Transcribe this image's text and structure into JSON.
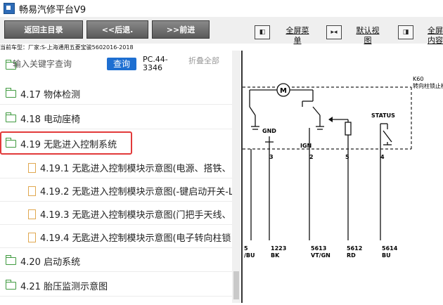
{
  "window": {
    "title": "畅易汽修平台V9"
  },
  "toolbar": {
    "back_main": "返回主目录",
    "back": "<<后退.",
    "forward": ">>前进",
    "view_buttons": [
      {
        "icon": "expand-left-icon",
        "label": "全屏菜单"
      },
      {
        "icon": "center-icon",
        "label": "默认视图"
      },
      {
        "icon": "expand-right-icon",
        "label": "全屏内容"
      }
    ]
  },
  "car_info": "当前车型：厂家:S-上海通用五菱宝骏5602016-2018",
  "search": {
    "placeholder": "输入关键字查询",
    "button": "查询",
    "code": "PC.44-3346",
    "collapse": "折叠全部"
  },
  "tree": [
    {
      "type": "folder",
      "label": "4.17 物体检测"
    },
    {
      "type": "folder",
      "label": "4.18 电动座椅"
    },
    {
      "type": "folder",
      "label": "4.19 无匙进入控制系统",
      "highlight": true
    },
    {
      "type": "doc",
      "label": "4.19.1 无匙进入控制模块示意图(电源、搭铁、"
    },
    {
      "type": "doc",
      "label": "4.19.2 无匙进入控制模块示意图(-键启动开关-L"
    },
    {
      "type": "doc",
      "label": "4.19.3 无匙进入控制模块示意图(门把手天线、"
    },
    {
      "type": "doc",
      "label": "4.19.4 无匙进入控制模块示意图(电子转向柱锁"
    },
    {
      "type": "folder",
      "label": "4.20 启动系统"
    },
    {
      "type": "folder",
      "label": "4.21 胎压监测示意图"
    }
  ],
  "diagram": {
    "module_id": "K60",
    "module_name": "转向柱锁止模块",
    "motor_symbol": "M",
    "labels": {
      "gnd": "GND",
      "ign": "IGN",
      "status": "STATUS"
    },
    "pins": [
      "3",
      "2",
      "5",
      "4"
    ],
    "wires": [
      {
        "circuit": "5",
        "color": "/BU"
      },
      {
        "circuit": "1223",
        "color": "BK"
      },
      {
        "circuit": "5613",
        "color": "VT/GN"
      },
      {
        "circuit": "5612",
        "color": "RD"
      },
      {
        "circuit": "5614",
        "color": "BU"
      }
    ]
  }
}
